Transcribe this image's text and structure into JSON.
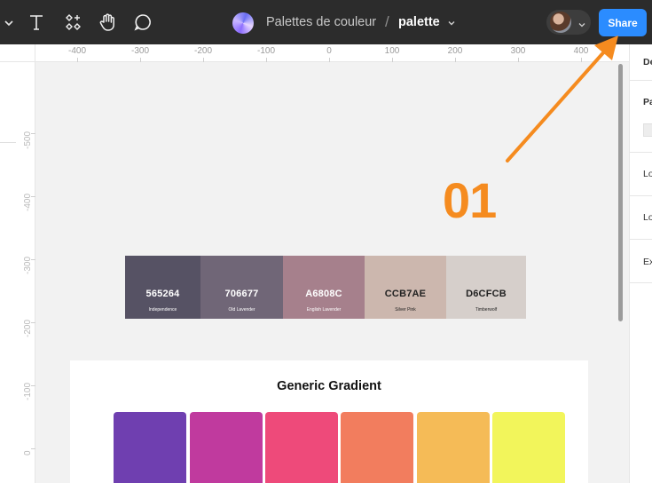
{
  "toolbar": {
    "project_name": "Palettes de couleur",
    "separator": "/",
    "file_name": "palette",
    "share_label": "Share",
    "tools": [
      "text-tool",
      "components-tool",
      "hand-tool",
      "comment-tool"
    ]
  },
  "rulers": {
    "horizontal_ticks": [
      "-400",
      "-300",
      "-200",
      "-100",
      "0",
      "100",
      "200",
      "300",
      "400"
    ],
    "vertical_ticks": [
      "-500",
      "-400",
      "-300",
      "-200",
      "-100",
      "0"
    ]
  },
  "palette": {
    "swatches": [
      {
        "hex": "565264",
        "name": "Independence",
        "color": "#565264",
        "text_color": "#ffffff"
      },
      {
        "hex": "706677",
        "name": "Old Lavender",
        "color": "#706677",
        "text_color": "#ffffff"
      },
      {
        "hex": "A6808C",
        "name": "English Lavender",
        "color": "#A6808C",
        "text_color": "#ffffff"
      },
      {
        "hex": "CCB7AE",
        "name": "Silver Pink",
        "color": "#CCB7AE",
        "text_color": "#222222"
      },
      {
        "hex": "D6CFCB",
        "name": "Timberwolf",
        "color": "#D6CFCB",
        "text_color": "#222222"
      }
    ]
  },
  "gradient": {
    "title": "Generic Gradient",
    "colors": [
      "#6f3fb0",
      "#c03a9e",
      "#ee4a7a",
      "#f27d5e",
      "#f5bb57",
      "#f2f55b"
    ]
  },
  "annotation": {
    "label": "01",
    "color": "#f58b1f"
  },
  "right_panel": {
    "labels": [
      "De",
      "Pa",
      "Lo",
      "Lo",
      "Ex"
    ]
  },
  "colors": {
    "toolbar_bg": "#2c2c2c",
    "share_blue": "#2b8cff",
    "canvas_bg": "#f2f2f2"
  }
}
